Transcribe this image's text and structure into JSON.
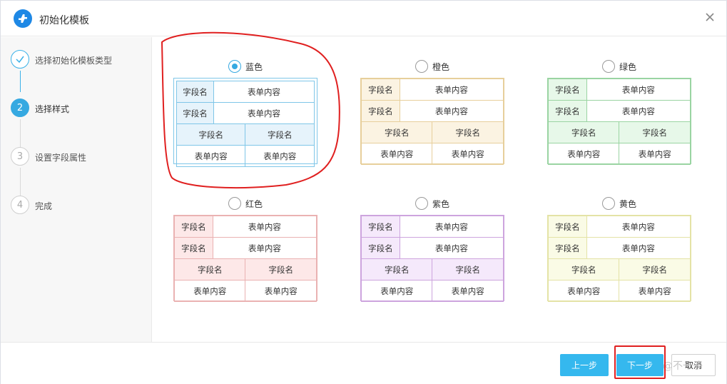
{
  "dialog": {
    "title": "初始化模板",
    "close_icon": "close-icon",
    "logo_icon": "app-logo-icon",
    "accent_color": "#36a9e1"
  },
  "steps": [
    {
      "number": "",
      "label": "选择初始化模板类型",
      "state": "done",
      "icon": "check-icon"
    },
    {
      "number": "2",
      "label": "选择样式",
      "state": "active"
    },
    {
      "number": "3",
      "label": "设置字段属性",
      "state": "todo"
    },
    {
      "number": "4",
      "label": "完成",
      "state": "todo"
    }
  ],
  "styles": [
    {
      "name": "蓝色",
      "checked": true,
      "head_color": "#e6f3fb",
      "border_color": "#7fc6e8",
      "field": "字段名",
      "value": "表单内容"
    },
    {
      "name": "橙色",
      "checked": false,
      "head_color": "#fbf3e2",
      "border_color": "#e7cf9b",
      "field": "字段名",
      "value": "表单内容"
    },
    {
      "name": "绿色",
      "checked": false,
      "head_color": "#e7f8e9",
      "border_color": "#9ad4a2",
      "field": "字段名",
      "value": "表单内容"
    },
    {
      "name": "红色",
      "checked": false,
      "head_color": "#fde8e8",
      "border_color": "#eab2b2",
      "field": "字段名",
      "value": "表单内容"
    },
    {
      "name": "紫色",
      "checked": false,
      "head_color": "#f5e9fb",
      "border_color": "#cda4de",
      "field": "字段名",
      "value": "表单内容"
    },
    {
      "name": "黄色",
      "checked": false,
      "head_color": "#fafbe6",
      "border_color": "#e4e3a6",
      "field": "字段名",
      "value": "表单内容"
    }
  ],
  "footer": {
    "prev_label": "上一步",
    "next_label": "下一步",
    "cancel_label": "取消",
    "watermark": "@不一子"
  }
}
